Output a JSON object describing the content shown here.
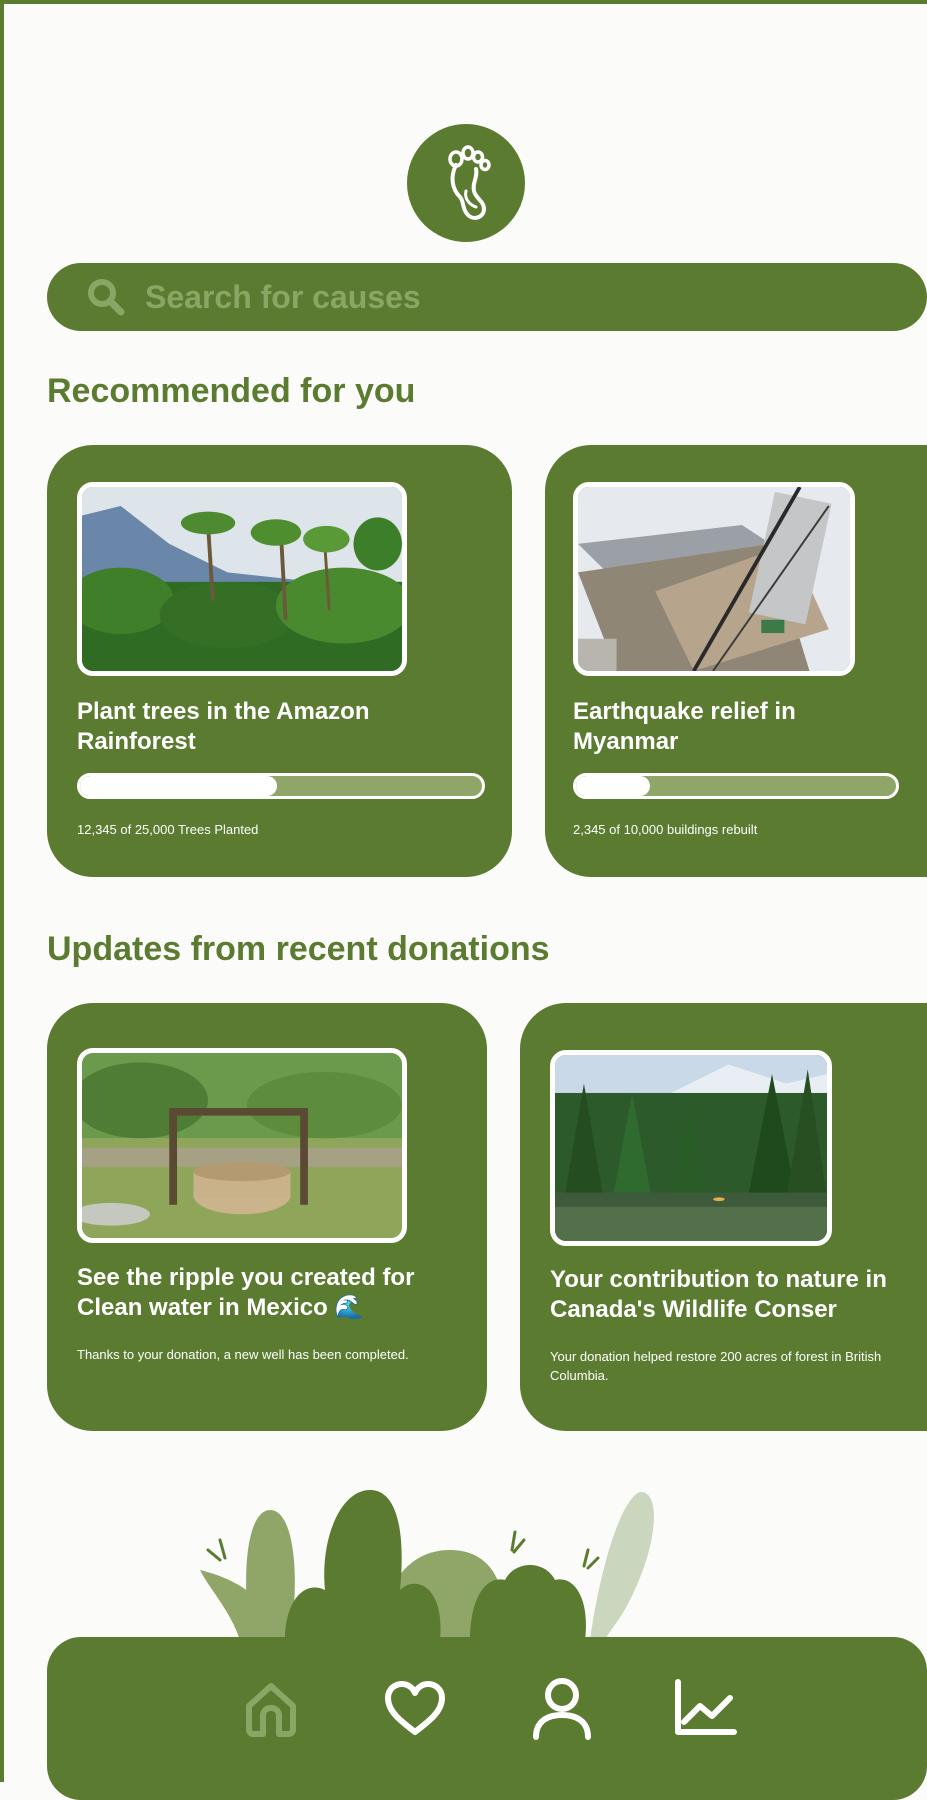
{
  "search": {
    "placeholder": "Search for causes"
  },
  "recommended": {
    "heading": "Recommended for you",
    "cards": [
      {
        "title": "Plant trees in the Amazon Rainforest",
        "progress_fraction": 0.49,
        "progress_text": "12,345 of 25,000 Trees Planted"
      },
      {
        "title": "Earthquake relief in Myanmar",
        "progress_fraction": 0.23,
        "progress_text": "2,345 of 10,000 buildings rebuilt"
      }
    ]
  },
  "updates": {
    "heading": "Updates from recent donations",
    "cards": [
      {
        "title": "See the ripple you created for Clean water in Mexico 🌊",
        "body": "Thanks to your donation, a new well has been completed."
      },
      {
        "title": "Your contribution to nature in Canada's Wildlife Conser",
        "body": "Your donation helped restore 200 acres of forest in British Columbia."
      }
    ]
  },
  "nav": {
    "items": [
      {
        "icon": "home-icon",
        "active": true
      },
      {
        "icon": "heart-icon",
        "active": false
      },
      {
        "icon": "user-icon",
        "active": false
      },
      {
        "icon": "chart-icon",
        "active": false
      }
    ]
  },
  "colors": {
    "brand": "#5b7b30",
    "muted": "#8aa664",
    "progress_track": "#90a668",
    "background": "#fbfbf9"
  }
}
